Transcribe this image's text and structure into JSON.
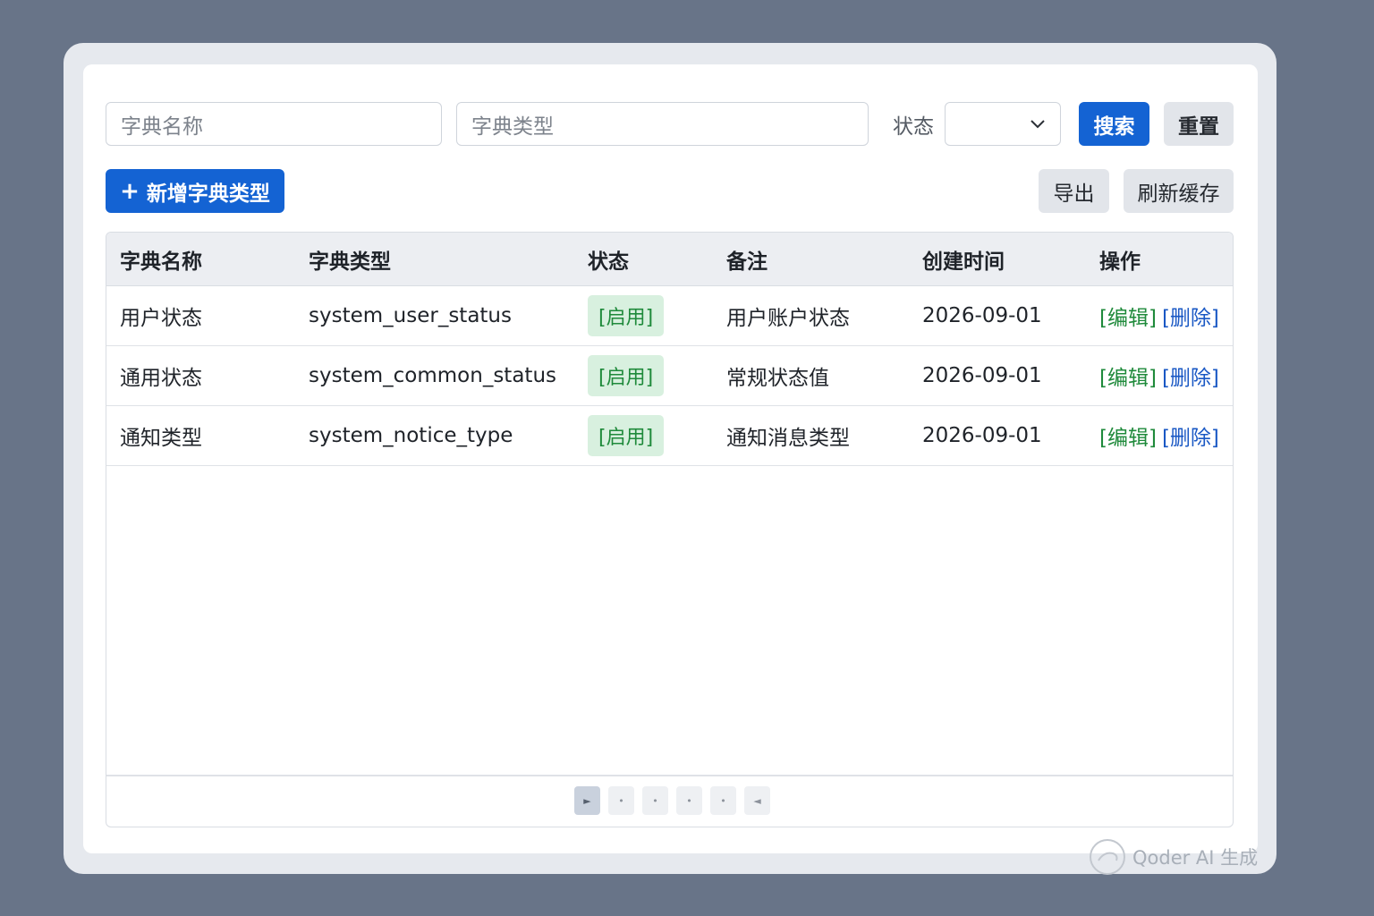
{
  "search": {
    "name_placeholder": "字典名称",
    "type_placeholder": "字典类型",
    "status_label": "状态",
    "status_value": "",
    "search_button": "搜索",
    "reset_button": "重置"
  },
  "toolbar": {
    "add_label": "新增字典类型",
    "add_icon": "plus-icon",
    "export_label": "导出",
    "refresh_label": "刷新缓存"
  },
  "table": {
    "columns": [
      "字典名称",
      "字典类型",
      "状态",
      "备注",
      "创建时间",
      "操作"
    ],
    "rows": [
      {
        "name": "用户状态",
        "type": "system_user_status",
        "status": "[启用]",
        "remark": "用户账户状态",
        "created": "2026-09-01",
        "edit": "[编辑]",
        "delete": "[删除]"
      },
      {
        "name": "通用状态",
        "type": "system_common_status",
        "status": "[启用]",
        "remark": "常规状态值",
        "created": "2026-09-01",
        "edit": "[编辑]",
        "delete": "[删除]"
      },
      {
        "name": "通知类型",
        "type": "system_notice_type",
        "status": "[启用]",
        "remark": "通知消息类型",
        "created": "2026-09-01",
        "edit": "[编辑]",
        "delete": "[删除]"
      }
    ]
  },
  "pagination": {
    "first": "►",
    "dots": [
      "•",
      "•",
      "•",
      "•"
    ],
    "last": "◄"
  },
  "watermark": "Qoder AI 生成",
  "colors": {
    "primary": "#1463d3",
    "status_green": "#1f8a3b",
    "status_bg": "#d8f0df",
    "delete_blue": "#1a58c4",
    "backdrop": "#687488"
  }
}
